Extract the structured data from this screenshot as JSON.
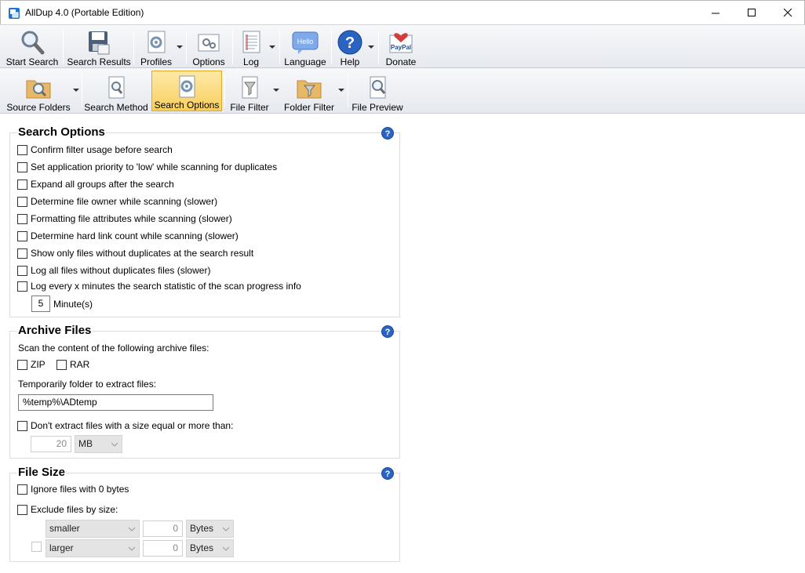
{
  "window": {
    "title": "AllDup 4.0 (Portable Edition)"
  },
  "toolbar1": {
    "items": [
      {
        "label": "Start Search",
        "icon": "magnifier-icon"
      },
      {
        "label": "Search Results",
        "icon": "save-disk-icon"
      },
      {
        "label": "Profiles",
        "icon": "profiles-icon"
      },
      {
        "label": "Options",
        "icon": "options-icon"
      },
      {
        "label": "Log",
        "icon": "log-icon"
      },
      {
        "label": "Language",
        "icon": "hello-bubble-icon",
        "icon_text": "Hello"
      },
      {
        "label": "Help",
        "icon": "help-icon"
      },
      {
        "label": "Donate",
        "icon": "paypal-icon",
        "icon_text": "PayPal"
      }
    ]
  },
  "toolbar2": {
    "items": [
      {
        "label": "Source Folders",
        "icon": "folder-search-icon"
      },
      {
        "label": "Search Method",
        "icon": "search-method-icon"
      },
      {
        "label": "Search Options",
        "icon": "search-options-icon",
        "active": true
      },
      {
        "label": "File Filter",
        "icon": "file-filter-icon"
      },
      {
        "label": "Folder Filter",
        "icon": "folder-filter-icon"
      },
      {
        "label": "File Preview",
        "icon": "file-preview-icon"
      }
    ]
  },
  "search_options": {
    "title": "Search Options",
    "checkboxes": [
      "Confirm filter usage before search",
      "Set application priority to 'low' while scanning for duplicates",
      "Expand all groups after the search",
      "Determine file owner while scanning (slower)",
      "Formatting file attributes while scanning (slower)",
      "Determine hard link count while scanning (slower)",
      "Show only files without duplicates at the search result",
      "Log all files without duplicates files (slower)",
      "Log every x minutes the search statistic of the scan progress info"
    ],
    "minutes_value": "5",
    "minutes_label": "Minute(s)"
  },
  "archive_files": {
    "title": "Archive Files",
    "scan_label": "Scan the content of the following archive files:",
    "zip_label": "ZIP",
    "rar_label": "RAR",
    "temp_label": "Temporarily folder to extract files:",
    "temp_value": "%temp%\\ADtemp",
    "size_limit_label": "Don't extract files with a size equal or more than:",
    "size_value": "20",
    "size_unit": "MB"
  },
  "file_size": {
    "title": "File Size",
    "ignore_zero_label": "Ignore files with 0 bytes",
    "exclude_label": "Exclude files by size:",
    "row1": {
      "compare": "smaller",
      "value": "0",
      "unit": "Bytes"
    },
    "row2": {
      "compare": "larger",
      "value": "0",
      "unit": "Bytes"
    }
  },
  "colors": {
    "active_tab": "#f9cf5d",
    "help_blue": "#2a63c1"
  }
}
